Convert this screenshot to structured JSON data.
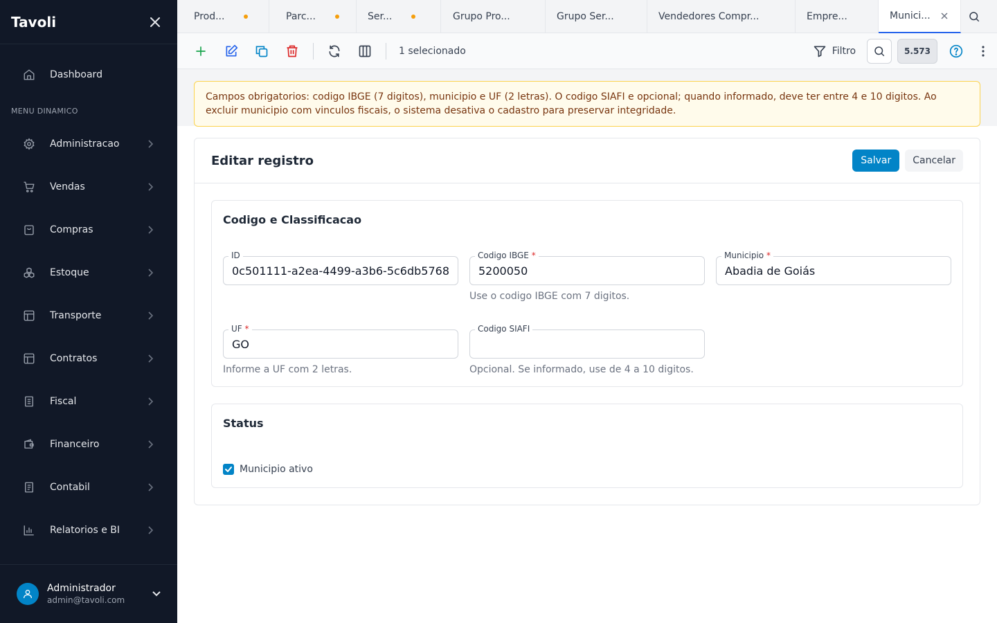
{
  "app": {
    "title": "Tavoli"
  },
  "sidebar": {
    "dashboard": "Dashboard",
    "section": "MENU DINAMICO",
    "items": [
      {
        "label": "Administracao",
        "icon": "gear-icon"
      },
      {
        "label": "Vendas",
        "icon": "cart-icon"
      },
      {
        "label": "Compras",
        "icon": "shopping-bag-icon"
      },
      {
        "label": "Estoque",
        "icon": "boxes-icon"
      },
      {
        "label": "Transporte",
        "icon": "panel-icon"
      },
      {
        "label": "Contratos",
        "icon": "panel-icon"
      },
      {
        "label": "Fiscal",
        "icon": "document-icon"
      },
      {
        "label": "Financeiro",
        "icon": "wallet-icon"
      },
      {
        "label": "Contabil",
        "icon": "ledger-icon"
      },
      {
        "label": "Relatorios e BI",
        "icon": "bar-chart-icon"
      }
    ],
    "user": {
      "name": "Administrador",
      "email": "admin@tavoli.com"
    }
  },
  "tabs": [
    {
      "label": "Prod...",
      "dirty": true
    },
    {
      "label": "Parc...",
      "dirty": true
    },
    {
      "label": "Ser...",
      "dirty": true
    },
    {
      "label": "Grupo Pro...",
      "dirty": false
    },
    {
      "label": "Grupo Ser...",
      "dirty": false
    },
    {
      "label": "Vendedores Compr...",
      "dirty": false
    },
    {
      "label": "Empre...",
      "dirty": false
    },
    {
      "label": "Munici...",
      "active": true
    }
  ],
  "toolbar": {
    "selected": "1 selecionado",
    "filter": "Filtro",
    "count": "5.573"
  },
  "alert": {
    "text": "Campos obrigatorios: codigo IBGE (7 digitos), municipio e UF (2 letras). O codigo SIAFI e opcional; quando informado, deve ter entre 4 e 10 digitos. Ao excluir municipio com vinculos fiscais, o sistema desativa o cadastro para preservar integridade."
  },
  "form": {
    "title": "Editar registro",
    "save": "Salvar",
    "cancel": "Cancelar",
    "section1": {
      "title": "Codigo e Classificacao",
      "id": {
        "label": "ID",
        "value": "0c501111-a2ea-4499-a3b6-5c6db5768"
      },
      "ibge": {
        "label": "Codigo IBGE",
        "value": "5200050",
        "help": "Use o codigo IBGE com 7 digitos."
      },
      "municipio": {
        "label": "Municipio",
        "value": "Abadia de Goiás"
      },
      "uf": {
        "label": "UF",
        "value": "GO",
        "help": "Informe a UF com 2 letras."
      },
      "siafi": {
        "label": "Codigo SIAFI",
        "value": "",
        "help": "Opcional. Se informado, use de 4 a 10 digitos."
      }
    },
    "section2": {
      "title": "Status",
      "active_label": "Municipio ativo",
      "active": true
    }
  },
  "colors": {
    "sidebar_bg": "#111827",
    "primary": "#0284c7",
    "add": "#16a34a",
    "edit": "#2563eb",
    "delete": "#dc2626",
    "tab_dot": "#f59e0b",
    "alert_bg": "#fffbeb",
    "alert_border": "#fcd34d"
  }
}
